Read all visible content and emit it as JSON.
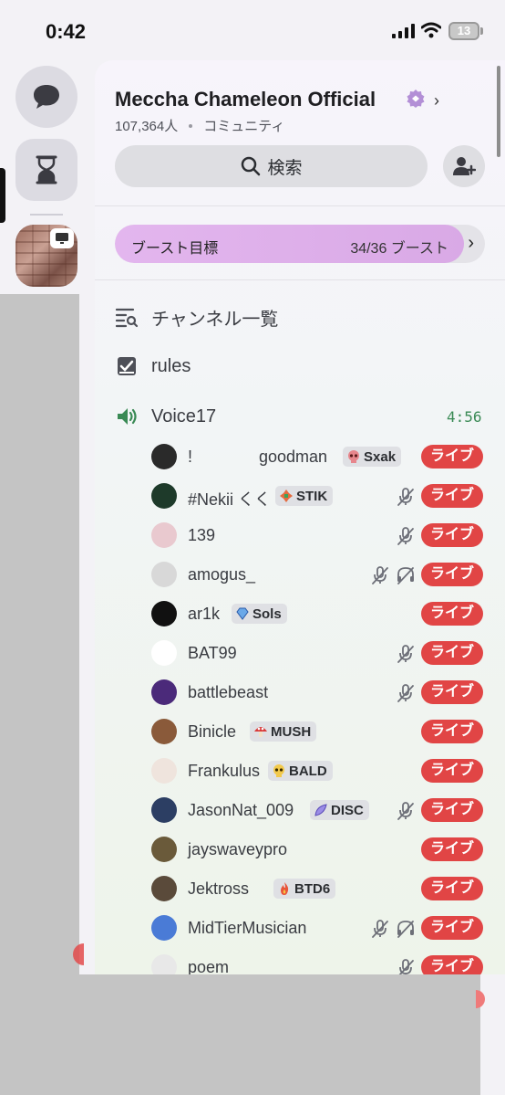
{
  "status_bar": {
    "time": "0:42",
    "battery": "13"
  },
  "server": {
    "name": "Meccha Chameleon Official",
    "members": "107,364人",
    "type": "コミュニティ",
    "search_label": "検索",
    "boost_label": "ブースト目標",
    "boost_count": "34/36 ブースト",
    "boost_progress": 0.944
  },
  "channels": [
    {
      "name": "チャンネル一覧",
      "icon": "channel-list-icon"
    },
    {
      "name": "rules",
      "icon": "rules-checkbox-icon"
    },
    {
      "name": "Voice17",
      "icon": "speaker-icon",
      "timer": "4:56"
    }
  ],
  "live_label": "ライブ",
  "members": [
    {
      "name": "!",
      "name2": "goodman",
      "tag": "Sxak",
      "tag_icon": "skull",
      "muted": false,
      "deafened": false,
      "avatar_color": "#2a2a2a"
    },
    {
      "name": "#Nekii くく",
      "tag": "STIK",
      "tag_icon": "cross",
      "muted": true,
      "deafened": false,
      "avatar_color": "#1e3a2a"
    },
    {
      "name": "139",
      "tag": "",
      "muted": true,
      "deafened": false,
      "avatar_color": "#e9c9cf"
    },
    {
      "name": "amogus_",
      "tag": "",
      "muted": true,
      "deafened": true,
      "avatar_color": "#d8d8d8"
    },
    {
      "name": "ar1k",
      "tag": "Sols",
      "tag_icon": "diamond",
      "muted": false,
      "deafened": false,
      "avatar_color": "#111111"
    },
    {
      "name": "BAT99",
      "tag": "",
      "muted": true,
      "deafened": false,
      "avatar_color": "#ffffff"
    },
    {
      "name": "battlebeast",
      "tag": "",
      "muted": true,
      "deafened": false,
      "avatar_color": "#4b2a7a"
    },
    {
      "name": "Binicle",
      "tag": "MUSH",
      "tag_icon": "mushroom",
      "muted": false,
      "deafened": false,
      "avatar_color": "#8a5a3a"
    },
    {
      "name": "Frankulus",
      "tag": "BALD",
      "tag_icon": "skull-yellow",
      "muted": false,
      "deafened": false,
      "avatar_color": "#efe4dd"
    },
    {
      "name": "JasonNat_009",
      "tag": "DISC",
      "tag_icon": "feather",
      "muted": true,
      "deafened": false,
      "avatar_color": "#2c3e63"
    },
    {
      "name": "jayswaveypro",
      "tag": "",
      "muted": false,
      "deafened": false,
      "avatar_color": "#6a5a3a"
    },
    {
      "name": "Jektross",
      "tag": "BTD6",
      "tag_icon": "fire",
      "muted": false,
      "deafened": false,
      "avatar_color": "#5a4a3a"
    },
    {
      "name": "MidTierMusician",
      "tag": "",
      "muted": true,
      "deafened": true,
      "avatar_color": "#4a7bd6"
    },
    {
      "name": "poem",
      "tag": "",
      "muted": true,
      "deafened": false,
      "avatar_color": "#e8e8e8"
    }
  ]
}
